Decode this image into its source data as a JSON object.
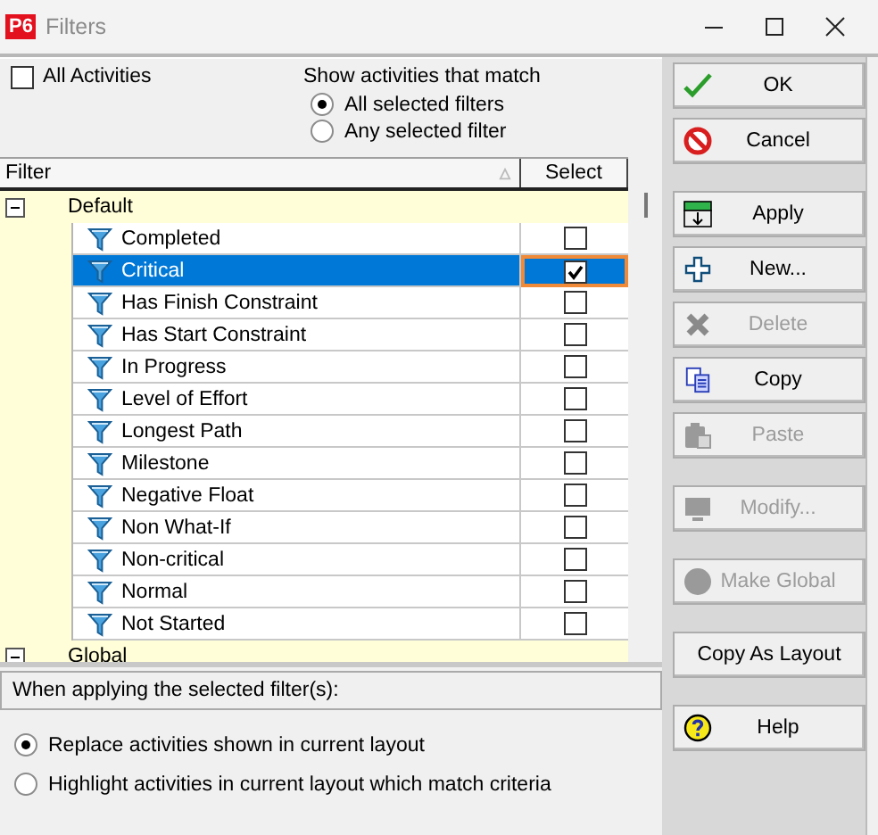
{
  "window": {
    "title": "Filters",
    "app_badge": "P6"
  },
  "all_activities": {
    "label": "All Activities",
    "checked": false
  },
  "match": {
    "label": "Show activities that match",
    "options": [
      {
        "label": "All selected filters",
        "selected": true
      },
      {
        "label": "Any selected filter",
        "selected": false
      }
    ]
  },
  "table": {
    "columns": [
      "Filter",
      "Select"
    ],
    "groups": [
      {
        "label": "Default",
        "expanded": true,
        "children": [
          {
            "label": "Completed",
            "selected": false,
            "checked": false
          },
          {
            "label": "Critical",
            "selected": true,
            "checked": true
          },
          {
            "label": "Has Finish Constraint",
            "selected": false,
            "checked": false
          },
          {
            "label": "Has Start Constraint",
            "selected": false,
            "checked": false
          },
          {
            "label": "In Progress",
            "selected": false,
            "checked": false
          },
          {
            "label": "Level of Effort",
            "selected": false,
            "checked": false
          },
          {
            "label": "Longest Path",
            "selected": false,
            "checked": false
          },
          {
            "label": "Milestone",
            "selected": false,
            "checked": false
          },
          {
            "label": "Negative Float",
            "selected": false,
            "checked": false
          },
          {
            "label": "Non What-If",
            "selected": false,
            "checked": false
          },
          {
            "label": "Non-critical",
            "selected": false,
            "checked": false
          },
          {
            "label": "Normal",
            "selected": false,
            "checked": false
          },
          {
            "label": "Not Started",
            "selected": false,
            "checked": false
          }
        ]
      },
      {
        "label": "Global",
        "expanded": true
      }
    ]
  },
  "apply_mode": {
    "label": "When applying the selected filter(s):",
    "options": [
      {
        "label": "Replace activities shown in current layout",
        "selected": true
      },
      {
        "label": "Highlight activities in current layout which match criteria",
        "selected": false
      }
    ]
  },
  "button_groups": [
    [
      {
        "label": "OK",
        "disabled": false
      },
      {
        "label": "Cancel",
        "disabled": false
      }
    ],
    [
      {
        "label": "Apply",
        "disabled": false
      },
      {
        "label": "New...",
        "disabled": false
      },
      {
        "label": "Delete",
        "disabled": true
      },
      {
        "label": "Copy",
        "disabled": false
      },
      {
        "label": "Paste",
        "disabled": true
      }
    ],
    [
      {
        "label": "Modify...",
        "disabled": true
      }
    ],
    [
      {
        "label": "Make Global",
        "disabled": true
      }
    ],
    [
      {
        "label": "Copy As Layout",
        "disabled": false
      }
    ],
    [
      {
        "label": "Help",
        "disabled": false
      }
    ]
  ]
}
